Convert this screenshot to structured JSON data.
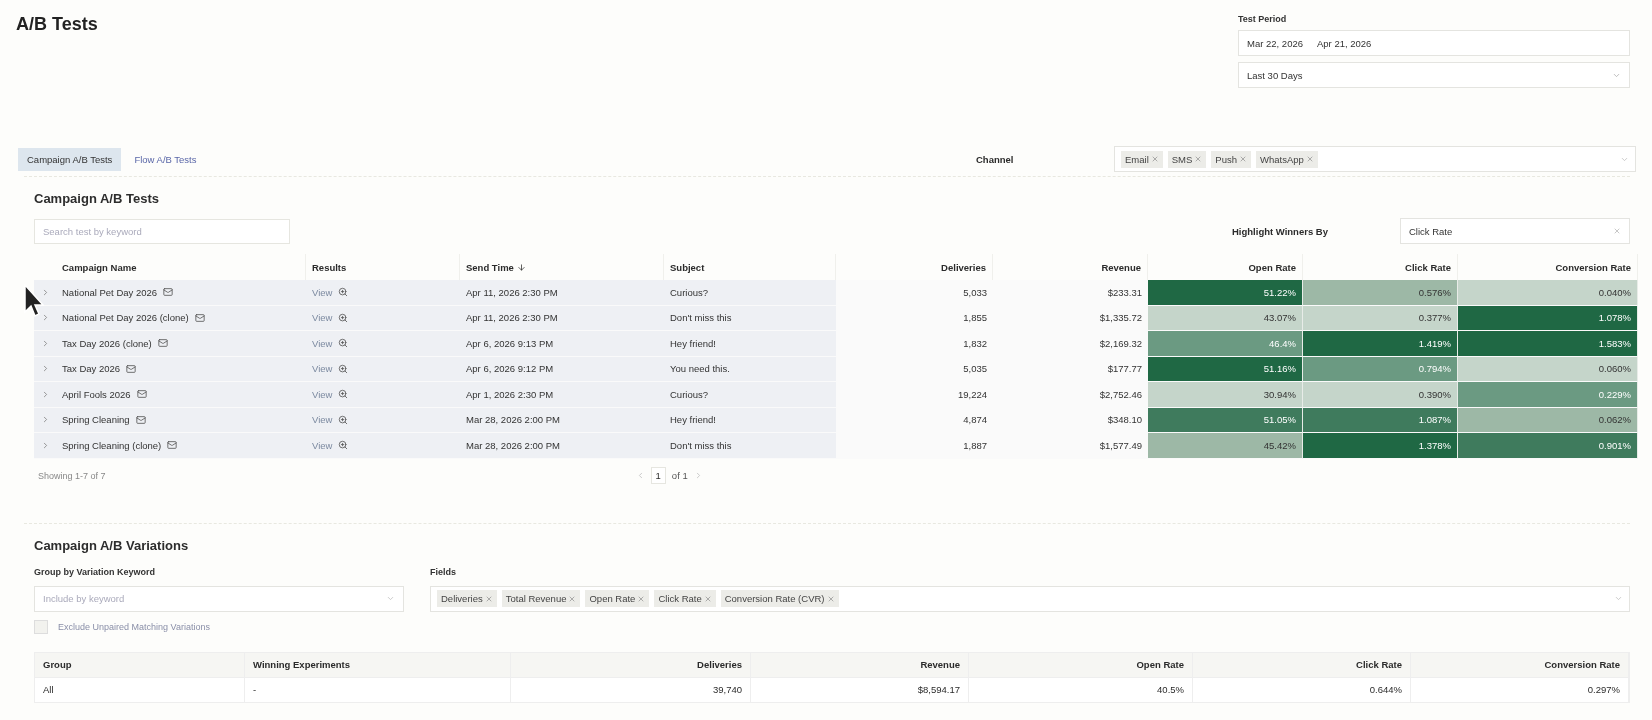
{
  "page_title": "A/B Tests",
  "test_period": {
    "label": "Test Period",
    "start": "Mar 22, 2026",
    "end": "Apr 21, 2026",
    "preset": "Last 30 Days"
  },
  "tabs": [
    {
      "label": "Campaign A/B Tests",
      "selected": true
    },
    {
      "label": "Flow A/B Tests",
      "selected": false
    }
  ],
  "channel": {
    "label": "Channel",
    "chips": [
      "Email",
      "SMS",
      "Push",
      "WhatsApp"
    ]
  },
  "tests": {
    "title": "Campaign A/B Tests",
    "search": {
      "placeholder": "Search test by keyword"
    },
    "highlight": {
      "label": "Highlight Winners By",
      "value": "Click Rate"
    },
    "columns": [
      {
        "label": "Campaign Name",
        "sorted": false
      },
      {
        "label": "Results",
        "sorted": false
      },
      {
        "label": "Send Time",
        "sorted": true
      },
      {
        "label": "Subject",
        "sorted": false
      },
      {
        "label": "Deliveries",
        "sorted": false
      },
      {
        "label": "Revenue",
        "sorted": false
      },
      {
        "label": "Open Rate",
        "sorted": false
      },
      {
        "label": "Click Rate",
        "sorted": false
      },
      {
        "label": "Conversion Rate",
        "sorted": false
      }
    ],
    "rows": [
      {
        "name": "National Pet Day 2026",
        "results": "View",
        "send_time": "Apr 11, 2026 2:30 PM",
        "subject": "Curious?",
        "deliveries": "5,033",
        "revenue": "$233.31",
        "rates": [
          {
            "value": "51.22%",
            "color": "#1f6844"
          },
          {
            "value": "0.576%",
            "color": "#9db8a6"
          },
          {
            "value": "0.040%",
            "color": "#c5d5ca"
          }
        ]
      },
      {
        "name": "National Pet Day 2026 (clone)",
        "results": "View",
        "send_time": "Apr 11, 2026 2:30 PM",
        "subject": "Don't miss this",
        "deliveries": "1,855",
        "revenue": "$1,335.72",
        "rates": [
          {
            "value": "43.07%",
            "color": "#c5d5ca"
          },
          {
            "value": "0.377%",
            "color": "#c5d5ca"
          },
          {
            "value": "1.078%",
            "color": "#1f6844"
          }
        ]
      },
      {
        "name": "Tax Day 2026 (clone)",
        "results": "View",
        "send_time": "Apr 6, 2026 9:13 PM",
        "subject": "Hey friend!",
        "deliveries": "1,832",
        "revenue": "$2,169.32",
        "rates": [
          {
            "value": "46.4%",
            "color": "#6b9a82"
          },
          {
            "value": "1.419%",
            "color": "#1f6844"
          },
          {
            "value": "1.583%",
            "color": "#1f6844"
          }
        ]
      },
      {
        "name": "Tax Day 2026",
        "results": "View",
        "send_time": "Apr 6, 2026 9:12 PM",
        "subject": "You need this.",
        "deliveries": "5,035",
        "revenue": "$177.77",
        "rates": [
          {
            "value": "51.16%",
            "color": "#1f6844"
          },
          {
            "value": "0.794%",
            "color": "#6b9a82"
          },
          {
            "value": "0.060%",
            "color": "#c5d5ca"
          }
        ]
      },
      {
        "name": "April Fools 2026",
        "results": "View",
        "send_time": "Apr 1, 2026 2:30 PM",
        "subject": "Curious?",
        "deliveries": "19,224",
        "revenue": "$2,752.46",
        "rates": [
          {
            "value": "30.94%",
            "color": "#c5d5ca"
          },
          {
            "value": "0.390%",
            "color": "#c5d5ca"
          },
          {
            "value": "0.229%",
            "color": "#6b9a82"
          }
        ]
      },
      {
        "name": "Spring Cleaning",
        "results": "View",
        "send_time": "Mar 28, 2026 2:00 PM",
        "subject": "Hey friend!",
        "deliveries": "4,874",
        "revenue": "$348.10",
        "rates": [
          {
            "value": "51.05%",
            "color": "#3f7b5d"
          },
          {
            "value": "1.087%",
            "color": "#3f7b5d"
          },
          {
            "value": "0.062%",
            "color": "#9db8a6"
          }
        ]
      },
      {
        "name": "Spring Cleaning (clone)",
        "results": "View",
        "send_time": "Mar 28, 2026 2:00 PM",
        "subject": "Don't miss this",
        "deliveries": "1,887",
        "revenue": "$1,577.49",
        "rates": [
          {
            "value": "45.42%",
            "color": "#9db8a6"
          },
          {
            "value": "1.378%",
            "color": "#1f6844"
          },
          {
            "value": "0.901%",
            "color": "#3f7b5d"
          }
        ]
      }
    ],
    "showing": "Showing 1-7 of 7",
    "page": "1",
    "page_total": "of 1"
  },
  "variations": {
    "title": "Campaign A/B Variations",
    "group_label": "Group by Variation Keyword",
    "group_placeholder": "Include by keyword",
    "fields_label": "Fields",
    "fields": [
      "Deliveries",
      "Total Revenue",
      "Open Rate",
      "Click Rate",
      "Conversion Rate (CVR)"
    ],
    "exclude": {
      "label": "Exclude Unpaired Matching Variations",
      "checked": false
    },
    "columns": [
      "Group",
      "Winning Experiments",
      "Deliveries",
      "Revenue",
      "Open Rate",
      "Click Rate",
      "Conversion Rate"
    ],
    "rows": [
      [
        "All",
        "-",
        "39,740",
        "$8,594.17",
        "40.5%",
        "0.644%",
        "0.297%"
      ]
    ]
  }
}
